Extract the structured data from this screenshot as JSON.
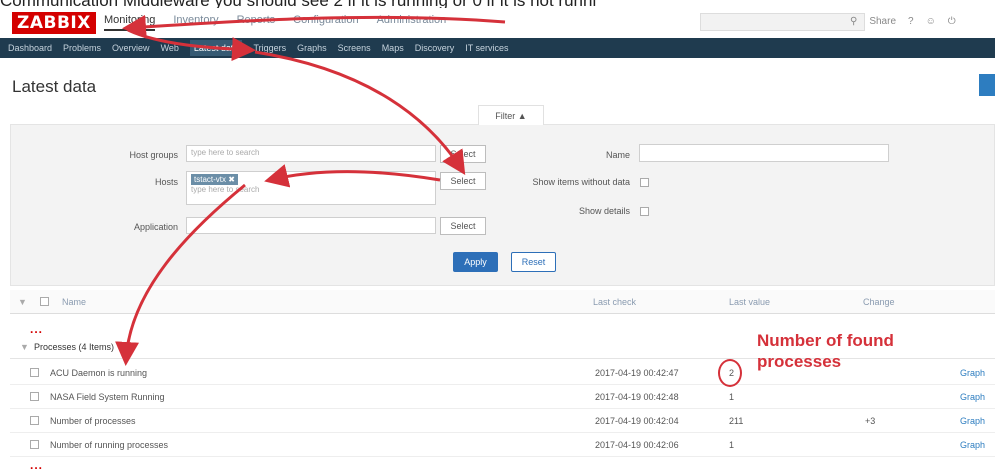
{
  "caption": "Communication Middleware you should see 2 if it is running or 0 if it is not runni",
  "brand": {
    "logo": "ZABBIX",
    "color": "#d40000"
  },
  "main_menu": [
    "Monitoring",
    "Inventory",
    "Reports",
    "Configuration",
    "Administration"
  ],
  "top_icons": [
    "Share",
    "?"
  ],
  "sub_nav": [
    "Dashboard",
    "Problems",
    "Overview",
    "Web",
    "Latest data",
    "Triggers",
    "Graphs",
    "Screens",
    "Maps",
    "Discovery",
    "IT services"
  ],
  "page_title": "Latest data",
  "filter": {
    "tab_label": "Filter ▲",
    "host_groups_label": "Host groups",
    "host_groups_placeholder": "type here to search",
    "hosts_label": "Hosts",
    "host_chip": "tstact-vtx",
    "hosts_placeholder": "type here to search",
    "application_label": "Application",
    "select_label": "Select",
    "name_label": "Name",
    "show_without_data_label": "Show items without data",
    "show_details_label": "Show details",
    "apply_label": "Apply",
    "reset_label": "Reset"
  },
  "table": {
    "headers": {
      "name": "Name",
      "last_check": "Last check",
      "last_value": "Last value",
      "change": "Change"
    },
    "group": "Processes (4 Items)",
    "rows": [
      {
        "name": "ACU Daemon is running",
        "last_check": "2017-04-19 00:42:47",
        "last_value": "2",
        "change": "",
        "link": "Graph"
      },
      {
        "name": "NASA Field System Running",
        "last_check": "2017-04-19 00:42:48",
        "last_value": "1",
        "change": "",
        "link": "Graph"
      },
      {
        "name": "Number of processes",
        "last_check": "2017-04-19 00:42:04",
        "last_value": "211",
        "change": "+3",
        "link": "Graph"
      },
      {
        "name": "Number of running processes",
        "last_check": "2017-04-19 00:42:06",
        "last_value": "1",
        "change": "",
        "link": "Graph"
      }
    ]
  },
  "annotation": {
    "line1": "Number of found",
    "line2": "processes",
    "color": "#d5313a"
  }
}
